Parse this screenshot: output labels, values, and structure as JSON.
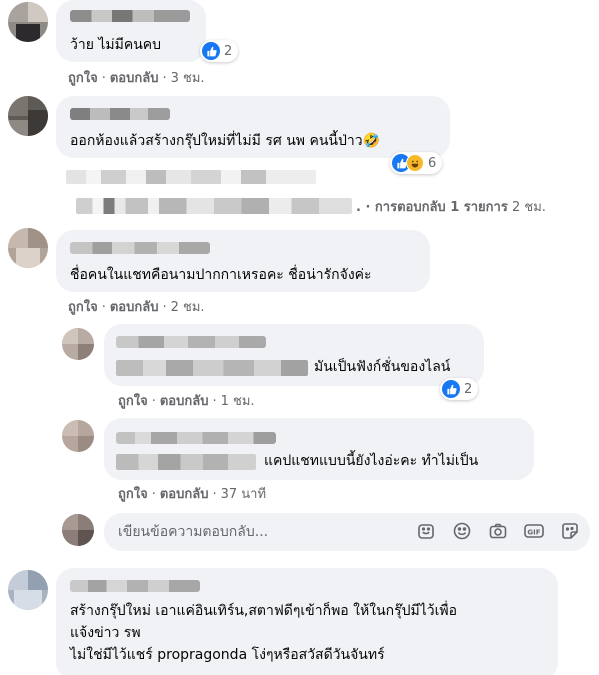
{
  "actions": {
    "like": "ถูกใจ",
    "separator": "·",
    "reply": "ตอบกลับ"
  },
  "comments": [
    {
      "text": "ว้าย ไม่มีคนคบ",
      "time": "3 ชม.",
      "reaction_count": "2"
    },
    {
      "text": "ออกห้องแล้วสร้างกรุ๊ปใหม่ที่ไม่มี รศ นพ คนนี้ป่าว🤣",
      "reaction_count": "6",
      "replies_summary": ". · การตอบกลับ 1 รายการ",
      "replies_time": "2 ชม."
    },
    {
      "text": "ชื่อคนในแชทคือนามปากกาเหรอคะ ชื่อน่ารักจังค่ะ",
      "time": "2 ชม."
    },
    {
      "text": "ไม่ใช่มีไว้แชร์ propragonda โง่ๆหรือสวัสดีวันจันทร์",
      "text_lines": [
        "สร้างกรุ๊ปใหม่ เอาแค่อินเทิร์น,สตาฟดีๆเข้าก็พอ ให้ในกรุ๊ปมีไว้เพื่อ",
        "แจ้งข่าว รพ",
        "ไม่ใช่มีไว้แชร์ propragonda โง่ๆหรือสวัสดีวันจันทร์"
      ]
    }
  ],
  "replies": [
    {
      "text": "มันเป็นฟังก์ชั่นของไลน์",
      "time": "1 ชม.",
      "reaction_count": "2"
    },
    {
      "text": "แคปแชทแบบนี้ยังไงอ่ะคะ ทำไม่เป็น",
      "time": "37 นาที"
    }
  ],
  "reply_input": {
    "placeholder": "เขียนข้อความตอบกลับ..."
  },
  "icons": [
    "like-icon",
    "haha-icon",
    "sticker-icon",
    "emoji-icon",
    "camera-icon",
    "gif-icon",
    "sticker-smile-icon"
  ],
  "colors": {
    "bubble": "#f0f2f5",
    "meta": "#65676b",
    "like_blue": "#1877f2"
  }
}
